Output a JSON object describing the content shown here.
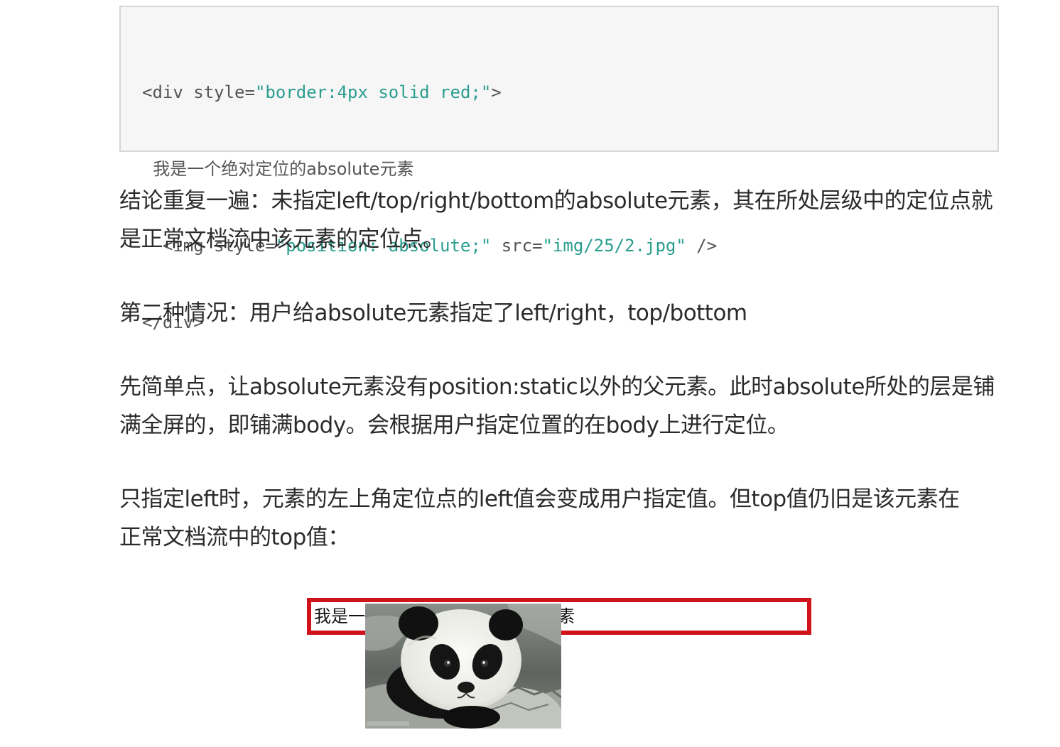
{
  "code": {
    "line1": [
      {
        "t": "<div style=",
        "c": "plain"
      },
      {
        "t": "\"border:4px solid red;\"",
        "c": "str"
      },
      {
        "t": ">",
        "c": "plain"
      }
    ],
    "line2_text": "  我是一个绝对定位的absolute元素",
    "line3": [
      {
        "t": "  <img style=",
        "c": "plain"
      },
      {
        "t": "\"position: absolute;\"",
        "c": "str"
      },
      {
        "t": " src=",
        "c": "plain"
      },
      {
        "t": "\"img/25/2.jpg\"",
        "c": "str"
      },
      {
        "t": " />",
        "c": "plain"
      }
    ],
    "line4_text": "</div>"
  },
  "paragraphs": {
    "p1": {
      "l1": "结论重复一遍：未指定left/top/right/bottom的absolute元素，其在所处层级中的定位点就",
      "l2": "是正常文档流中该元素的定位点。"
    },
    "p2": {
      "l1": "第二种情况：用户给absolute元素指定了left/right，top/bottom"
    },
    "p3": {
      "l1": "先简单点，让absolute元素没有position:static以外的父元素。此时absolute所处的层是铺",
      "l2": "满全屏的，即铺满body。会根据用户指定位置的在body上进行定位。"
    },
    "p4": {
      "l1": "只指定left时，元素的左上角定位点的left值会变成用户指定值。但top值仍旧是该元素在",
      "l2": "正常文档流中的top值："
    }
  },
  "demo": {
    "box_text": "我是一个绝对定位的absolute元素",
    "image_icon": "panda-photo",
    "border_color": "#d0121b"
  },
  "colors": {
    "code_string": "#2a9d8f",
    "code_plain": "#555555",
    "code_bg": "#f6f6f6",
    "body_text": "#2b2b2b"
  }
}
